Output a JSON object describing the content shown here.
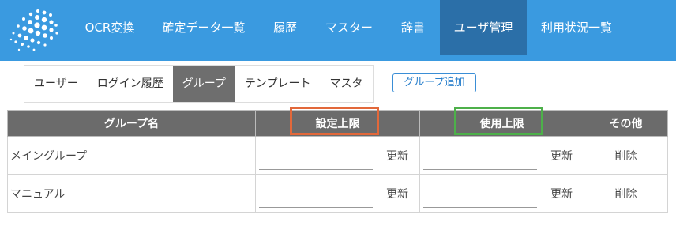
{
  "nav": {
    "items": [
      {
        "label": "OCR変換"
      },
      {
        "label": "確定データ一覧"
      },
      {
        "label": "履歴"
      },
      {
        "label": "マスター"
      },
      {
        "label": "辞書"
      },
      {
        "label": "ユーザ管理",
        "active": true
      },
      {
        "label": "利用状況一覧"
      }
    ]
  },
  "subtabs": {
    "items": [
      {
        "label": "ユーザー"
      },
      {
        "label": "ログイン履歴"
      },
      {
        "label": "グループ",
        "active": true
      },
      {
        "label": "テンプレート"
      },
      {
        "label": "マスタ"
      }
    ],
    "add_button": "グループ追加"
  },
  "table": {
    "headers": {
      "name": "グループ名",
      "limit_setting": "設定上限",
      "limit_used": "使用上限",
      "other": "その他"
    },
    "rows": [
      {
        "name": "メイングループ",
        "setting_value": "",
        "used_value": "",
        "update1": "更新",
        "update2": "更新",
        "delete": "削除"
      },
      {
        "name": "マニュアル",
        "setting_value": "",
        "used_value": "",
        "update1": "更新",
        "update2": "更新",
        "delete": "削除"
      }
    ]
  },
  "colors": {
    "nav_bg": "#3a9ae0",
    "nav_active": "#2b6fa8",
    "header_bg": "#6b6b6b",
    "highlight_setting": "#e2683a",
    "highlight_used": "#4db04a"
  },
  "icons": {
    "logo": "dotted-sphere-logo"
  }
}
